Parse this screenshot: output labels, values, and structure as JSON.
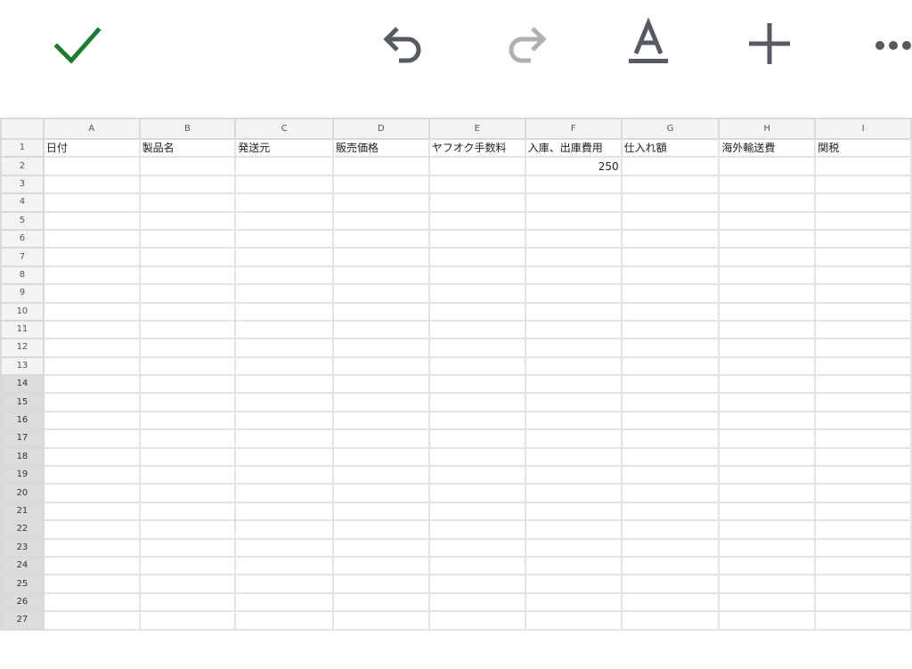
{
  "toolbar": {
    "done_icon": "check-icon",
    "undo_icon": "undo-icon",
    "redo_icon": "redo-icon",
    "format_icon": "text-format-icon",
    "format_glyph": "A",
    "insert_icon": "plus-icon",
    "more_icon": "more-horizontal-icon",
    "done_color": "#1e7b34",
    "icon_color": "#555a60",
    "disabled_color": "#b0b0b0"
  },
  "sheet": {
    "columns": [
      "A",
      "B",
      "C",
      "D",
      "E",
      "F",
      "G",
      "H",
      "I"
    ],
    "row_numbers": [
      "1",
      "2",
      "3",
      "4",
      "5",
      "6",
      "7",
      "8",
      "9",
      "10",
      "11",
      "12",
      "13",
      "14",
      "15",
      "16",
      "17",
      "18",
      "19",
      "20",
      "21",
      "22",
      "23",
      "24",
      "25",
      "26",
      "27"
    ],
    "selected_rows": [
      "14",
      "15",
      "16",
      "17",
      "18",
      "19",
      "20",
      "21",
      "22",
      "23",
      "24",
      "25",
      "26",
      "27"
    ],
    "header_row": [
      "日付",
      "製品名",
      "発送元",
      "販売価格",
      "ヤフオク手数料",
      "入庫、出庫費用",
      "仕入れ額",
      "海外輸送費",
      "関税"
    ],
    "row2": [
      "",
      "",
      "",
      "",
      "",
      "250",
      "",
      "",
      ""
    ]
  }
}
